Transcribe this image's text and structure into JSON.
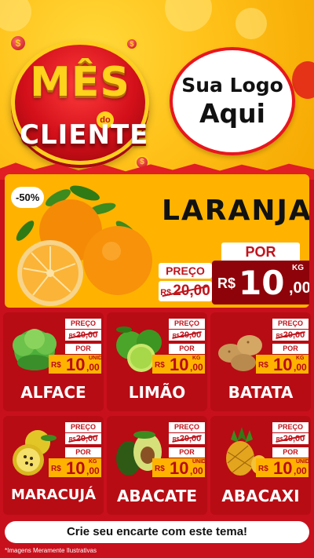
{
  "header": {
    "badge_title": "MÊS",
    "badge_do": "do",
    "badge_sub": "CLIENTE",
    "coin_symbol": "$",
    "logo_line1": "Sua Logo",
    "logo_line2": "Aqui"
  },
  "hero": {
    "discount": "-50%",
    "name": "LARANJA",
    "preco_label": "PREÇO",
    "old_currency": "R$",
    "old_price": "20,00",
    "por_label": "POR",
    "currency": "R$",
    "price_int": "10",
    "price_dec": ",00",
    "unit": "KG"
  },
  "products": [
    {
      "name": "ALFACE",
      "preco_label": "PREÇO",
      "old_currency": "R$",
      "old_price": "20,00",
      "por_label": "POR",
      "currency": "R$",
      "price_int": "10",
      "price_dec": ",00",
      "unit": "UNID"
    },
    {
      "name": "LIMÃO",
      "preco_label": "PREÇO",
      "old_currency": "R$",
      "old_price": "20,00",
      "por_label": "POR",
      "currency": "R$",
      "price_int": "10",
      "price_dec": ",00",
      "unit": "KG"
    },
    {
      "name": "BATATA",
      "preco_label": "PREÇO",
      "old_currency": "R$",
      "old_price": "20,00",
      "por_label": "POR",
      "currency": "R$",
      "price_int": "10",
      "price_dec": ",00",
      "unit": "KG"
    },
    {
      "name": "MARACUJÁ",
      "preco_label": "PREÇO",
      "old_currency": "R$",
      "old_price": "20,00",
      "por_label": "POR",
      "currency": "R$",
      "price_int": "10",
      "price_dec": ",00",
      "unit": "KG"
    },
    {
      "name": "ABACATE",
      "preco_label": "PREÇO",
      "old_currency": "R$",
      "old_price": "20,00",
      "por_label": "POR",
      "currency": "R$",
      "price_int": "10",
      "price_dec": ",00",
      "unit": "UNID"
    },
    {
      "name": "ABACAXI",
      "preco_label": "PREÇO",
      "old_currency": "R$",
      "old_price": "20,00",
      "por_label": "POR",
      "currency": "R$",
      "price_int": "10",
      "price_dec": ",00",
      "unit": "UNID"
    }
  ],
  "footer": {
    "cta": "Crie seu encarte com este tema!",
    "disclaimer": "*Imagens Meramente Ilustrativas"
  },
  "colors": {
    "background_red": "#c8101c",
    "card_red": "#b70c14",
    "yellow": "#ffb300",
    "dark_red": "#8e0309"
  }
}
